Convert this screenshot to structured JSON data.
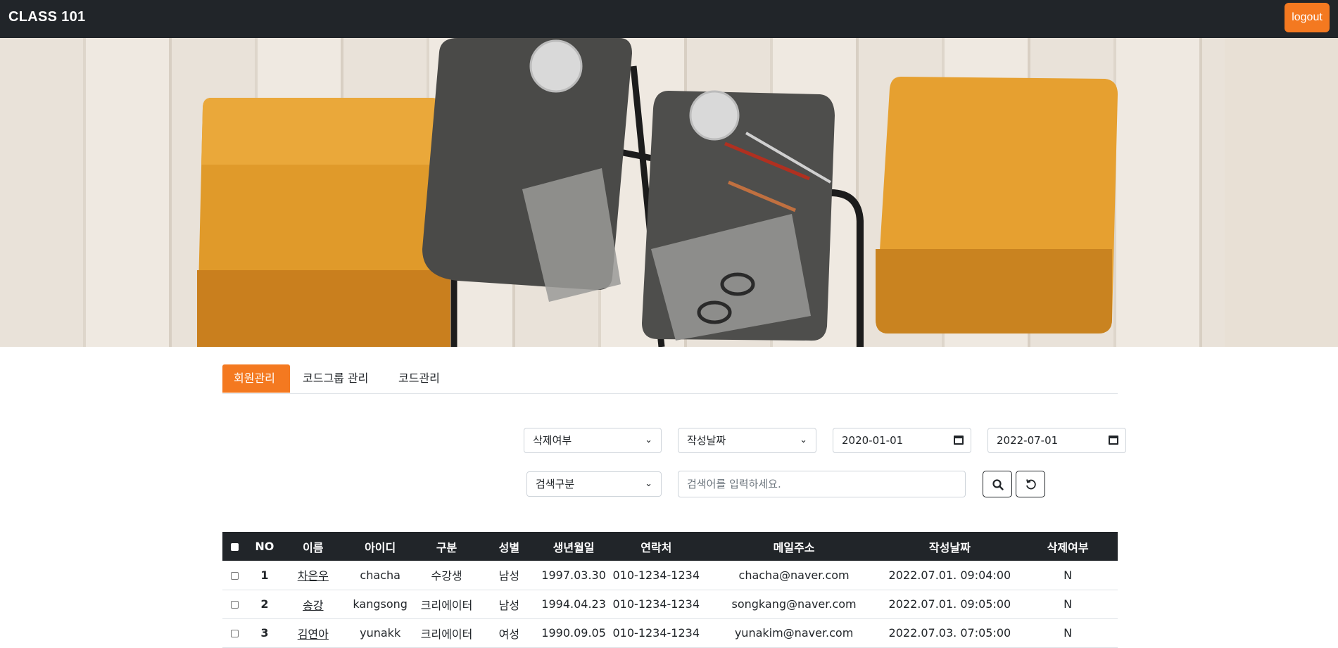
{
  "header": {
    "brand": "CLASS 101",
    "logout_label": "logout"
  },
  "tabs": [
    {
      "label": "회원관리",
      "active": true
    },
    {
      "label": "코드그룹 관리",
      "active": false
    },
    {
      "label": "코드관리",
      "active": false
    }
  ],
  "filters": {
    "delete_select": "삭제여부",
    "date_type_select": "작성날짜",
    "start_date": "2020-01-01",
    "end_date": "2022-07-01",
    "search_type_select": "검색구분",
    "search_placeholder": "검색어를 입력하세요.",
    "search_icon": "search-icon",
    "reset_icon": "reset-icon"
  },
  "table": {
    "columns": [
      "NO",
      "이름",
      "아이디",
      "구분",
      "성별",
      "생년월일",
      "연락처",
      "메일주소",
      "작성날짜",
      "삭제여부"
    ],
    "rows": [
      {
        "no": "1",
        "name": "차은우",
        "id": "chacha",
        "type": "수강생",
        "gender": "남성",
        "birth": "1997.03.30",
        "phone": "010-1234-1234",
        "email": "chacha@naver.com",
        "created": "2022.07.01. 09:04:00",
        "deleted": "N"
      },
      {
        "no": "2",
        "name": "송강",
        "id": "kangsong",
        "type": "크리에이터",
        "gender": "남성",
        "birth": "1994.04.23",
        "phone": "010-1234-1234",
        "email": "songkang@naver.com",
        "created": "2022.07.01. 09:05:00",
        "deleted": "N"
      },
      {
        "no": "3",
        "name": "김연아",
        "id": "yunakk",
        "type": "크리에이터",
        "gender": "여성",
        "birth": "1990.09.05",
        "phone": "010-1234-1234",
        "email": "yunakim@naver.com",
        "created": "2022.07.03. 07:05:00",
        "deleted": "N"
      }
    ]
  },
  "colors": {
    "accent": "#f47920",
    "dark": "#212529"
  }
}
